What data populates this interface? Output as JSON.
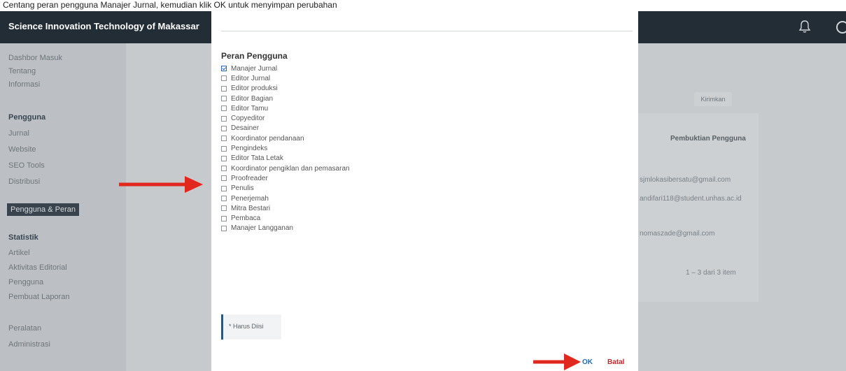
{
  "instruction": "Centang peran pengguna Manajer Jurnal, kemudian klik OK untuk menyimpan perubahan",
  "header": {
    "site_title": "Science Innovation Technology of Makassar",
    "bell_icon": "bell-icon",
    "avatar_icon": "user-avatar"
  },
  "sidebar": {
    "items_top": [
      "Dashbor Masuk",
      "Tentang",
      "Informasi"
    ],
    "section_pengguna": "Pengguna",
    "items_pengguna": [
      "Jurnal",
      "Website",
      "SEO Tools",
      "Distribusi"
    ],
    "active_item": "Pengguna & Peran",
    "section_utility": "Statistik",
    "items_utility": [
      "Artikel",
      "Aktivitas Editorial",
      "Pengguna",
      "Pembuat Laporan"
    ],
    "items_bottom": [
      "Peralatan",
      "Administrasi"
    ]
  },
  "background": {
    "tab_label": "Kirimkan",
    "panel_title": "Pembuktian Pengguna",
    "emails": [
      "sjmlokasibersatu@gmail.com",
      "andifari118@student.unhas.ac.id",
      "nomaszade@gmail.com"
    ],
    "pagination": "1 – 3 dari 3 item"
  },
  "modal": {
    "section_label": "Peran Pengguna",
    "roles": [
      {
        "label": "Manajer Jurnal",
        "checked": true
      },
      {
        "label": "Editor Jurnal",
        "checked": false
      },
      {
        "label": "Editor produksi",
        "checked": false
      },
      {
        "label": "Editor Bagian",
        "checked": false
      },
      {
        "label": "Editor Tamu",
        "checked": false
      },
      {
        "label": "Copyeditor",
        "checked": false
      },
      {
        "label": "Desainer",
        "checked": false
      },
      {
        "label": "Koordinator pendanaan",
        "checked": false
      },
      {
        "label": "Pengindeks",
        "checked": false
      },
      {
        "label": "Editor Tata Letak",
        "checked": false
      },
      {
        "label": "Koordinator pengiklan dan pemasaran",
        "checked": false
      },
      {
        "label": "Proofreader",
        "checked": false
      },
      {
        "label": "Penulis",
        "checked": false
      },
      {
        "label": "Penerjemah",
        "checked": false
      },
      {
        "label": "Mitra Bestari",
        "checked": false
      },
      {
        "label": "Pembaca",
        "checked": false
      },
      {
        "label": "Manajer Langganan",
        "checked": false
      }
    ],
    "required_note": "* Harus Diisi",
    "ok_label": "OK",
    "cancel_label": "Batal"
  },
  "colors": {
    "header_bg": "#222d35",
    "arrow": "#e0281e",
    "ok": "#1a6fb3",
    "cancel": "#c62828"
  }
}
